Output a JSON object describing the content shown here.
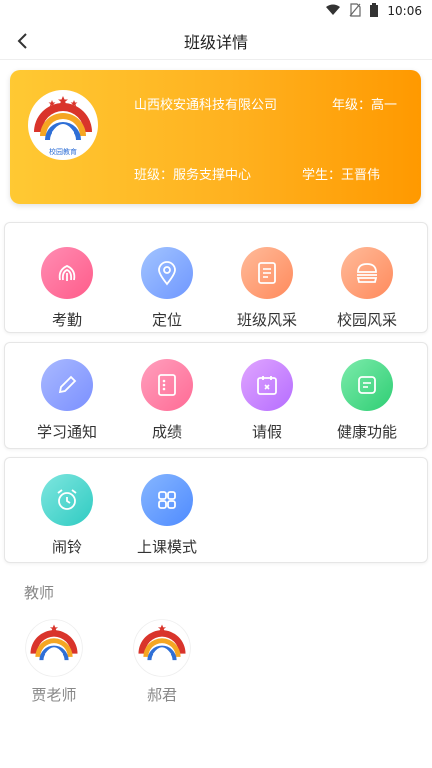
{
  "status_bar": {
    "time": "10:06"
  },
  "nav": {
    "title": "班级详情"
  },
  "banner": {
    "company": "山西校安通科技有限公司",
    "grade": "年级：高一",
    "class": "班级：服务支撑中心",
    "student": "学生：王晋伟",
    "logo_text": "校园教育"
  },
  "menu_rows": [
    [
      {
        "label": "考勤",
        "icon": "fingerprint-icon",
        "gradient": [
          "#ff7aa8",
          "#ff5c8a"
        ]
      },
      {
        "label": "定位",
        "icon": "location-pin-icon",
        "gradient": [
          "#8fb8ff",
          "#6f97ff"
        ]
      },
      {
        "label": "班级风采",
        "icon": "document-icon",
        "gradient": [
          "#ffb08a",
          "#ff8a5c"
        ]
      },
      {
        "label": "校园风采",
        "icon": "burger-icon",
        "gradient": [
          "#ffb08a",
          "#ff8a5c"
        ]
      }
    ],
    [
      {
        "label": "学习通知",
        "icon": "pencil-icon",
        "gradient": [
          "#9bb0ff",
          "#7b90ff"
        ]
      },
      {
        "label": "成绩",
        "icon": "notebook-icon",
        "gradient": [
          "#ff8fb0",
          "#ff6b95"
        ]
      },
      {
        "label": "请假",
        "icon": "calendar-icon",
        "gradient": [
          "#d796ff",
          "#b56dff"
        ]
      },
      {
        "label": "健康功能",
        "icon": "health-card-icon",
        "gradient": [
          "#63e59b",
          "#2fce74"
        ]
      }
    ],
    [
      {
        "label": "闹铃",
        "icon": "alarm-clock-icon",
        "gradient": [
          "#62e0d7",
          "#2fcbc2"
        ]
      },
      {
        "label": "上课模式",
        "icon": "grid-icon",
        "gradient": [
          "#6fa8ff",
          "#4f8bff"
        ]
      }
    ]
  ],
  "teachers_section": {
    "title": "教师"
  },
  "teachers": [
    {
      "name": "贾老师"
    },
    {
      "name": "郝君"
    }
  ],
  "colors": {
    "banner_start": "#ffc933",
    "banner_end": "#ff9900",
    "muted_text": "#888888"
  }
}
